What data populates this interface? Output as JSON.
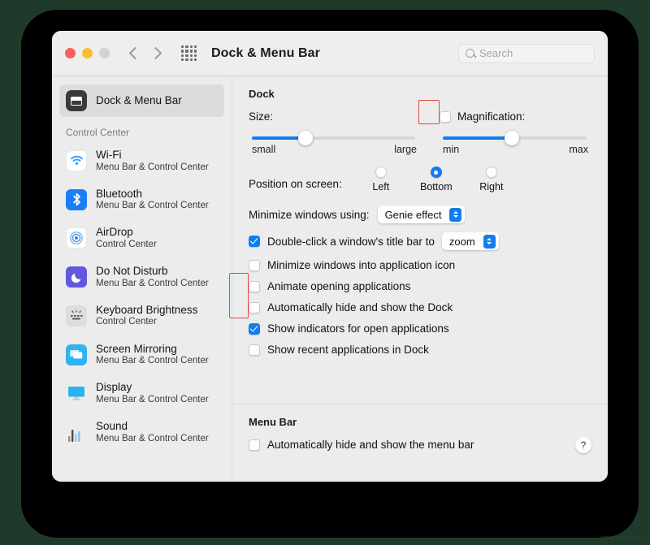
{
  "window": {
    "title": "Dock & Menu Bar",
    "traffic_lights": [
      "close",
      "minimize",
      "zoom"
    ],
    "back_label": "Back",
    "forward_label": "Forward",
    "grid_label": "Show All",
    "search": {
      "placeholder": "Search",
      "value": ""
    }
  },
  "sidebar": {
    "selected": {
      "title": "Dock & Menu Bar",
      "icon": "dock-icon"
    },
    "group_label": "Control Center",
    "items": [
      {
        "title": "Wi-Fi",
        "subtitle": "Menu Bar & Control Center",
        "icon": "wifi-icon"
      },
      {
        "title": "Bluetooth",
        "subtitle": "Menu Bar & Control Center",
        "icon": "bluetooth-icon"
      },
      {
        "title": "AirDrop",
        "subtitle": "Control Center",
        "icon": "airdrop-icon"
      },
      {
        "title": "Do Not Disturb",
        "subtitle": "Menu Bar & Control Center",
        "icon": "moon-icon"
      },
      {
        "title": "Keyboard Brightness",
        "subtitle": "Control Center",
        "icon": "keyboard-icon"
      },
      {
        "title": "Screen Mirroring",
        "subtitle": "Menu Bar & Control Center",
        "icon": "screen-mirroring-icon"
      },
      {
        "title": "Display",
        "subtitle": "Menu Bar & Control Center",
        "icon": "display-icon"
      },
      {
        "title": "Sound",
        "subtitle": "Menu Bar & Control Center",
        "icon": "sound-icon"
      }
    ]
  },
  "main": {
    "dock_section_title": "Dock",
    "size": {
      "label": "Size:",
      "min_label": "small",
      "max_label": "large",
      "percent": 33
    },
    "magnification": {
      "label": "Magnification:",
      "checked": false,
      "min_label": "min",
      "max_label": "max",
      "percent": 48
    },
    "position": {
      "label": "Position on screen:",
      "options": [
        "Left",
        "Bottom",
        "Right"
      ],
      "selected": "Bottom"
    },
    "minimize": {
      "label": "Minimize windows using:",
      "value": "Genie effect"
    },
    "double_click": {
      "label": "Double-click a window's title bar to",
      "checked": true,
      "value": "zoom"
    },
    "checkboxes": [
      {
        "label": "Minimize windows into application icon",
        "checked": false
      },
      {
        "label": "Animate opening applications",
        "checked": false
      },
      {
        "label": "Automatically hide and show the Dock",
        "checked": false
      },
      {
        "label": "Show indicators for open applications",
        "checked": true
      },
      {
        "label": "Show recent applications in Dock",
        "checked": false
      }
    ],
    "menu_bar_section_title": "Menu Bar",
    "menu_bar_checkbox": {
      "label": "Automatically hide and show the menu bar",
      "checked": false
    },
    "help_label": "?"
  },
  "colors": {
    "accent": "#147cf0",
    "highlight": "#e2483c",
    "desktop": "#1f3a2b"
  },
  "watermark": "www.sauq.com"
}
